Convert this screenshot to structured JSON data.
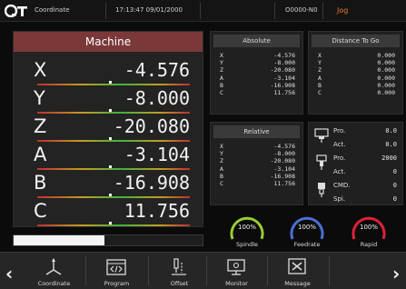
{
  "header": {
    "title": "Coordinate",
    "datetime": "17:13:47 09/01/2000",
    "program": "O0000-N0",
    "mode": "Jog",
    "logo_text": "QT"
  },
  "machine": {
    "title": "Machine",
    "axes": [
      {
        "label": "X",
        "value": "-4.576"
      },
      {
        "label": "Y",
        "value": "-8.000"
      },
      {
        "label": "Z",
        "value": "-20.080"
      },
      {
        "label": "A",
        "value": "-3.104"
      },
      {
        "label": "B",
        "value": "-16.908"
      },
      {
        "label": "C",
        "value": "11.756"
      }
    ]
  },
  "absolute": {
    "title": "Absolute",
    "rows": [
      {
        "label": "X",
        "value": "-4.576"
      },
      {
        "label": "Y",
        "value": "-8.000"
      },
      {
        "label": "Z",
        "value": "-20.080"
      },
      {
        "label": "A",
        "value": "-3.104"
      },
      {
        "label": "B",
        "value": "-16.908"
      },
      {
        "label": "C",
        "value": "11.756"
      }
    ]
  },
  "distance": {
    "title": "Distance To Go",
    "rows": [
      {
        "label": "X",
        "value": "0.000"
      },
      {
        "label": "Y",
        "value": "0.000"
      },
      {
        "label": "Z",
        "value": "0.000"
      },
      {
        "label": "A",
        "value": "0.000"
      },
      {
        "label": "B",
        "value": "0.000"
      },
      {
        "label": "C",
        "value": "0.000"
      }
    ]
  },
  "relative": {
    "title": "Relative",
    "rows": [
      {
        "label": "X",
        "value": "-4.576"
      },
      {
        "label": "Y",
        "value": "-8.000"
      },
      {
        "label": "Z",
        "value": "-20.080"
      },
      {
        "label": "A",
        "value": "-3.104"
      },
      {
        "label": "B",
        "value": "-16.908"
      },
      {
        "label": "C",
        "value": "11.756"
      }
    ]
  },
  "status": {
    "rows": [
      {
        "label": "Pro.",
        "value": "0.0",
        "icon": "feed-icon"
      },
      {
        "label": "Act.",
        "value": "0.0",
        "icon": ""
      },
      {
        "label": "Pro.",
        "value": "2000",
        "icon": "spindle-icon"
      },
      {
        "label": "Act.",
        "value": "0",
        "icon": ""
      },
      {
        "label": "CMD.",
        "value": "0",
        "icon": "tool-icon"
      },
      {
        "label": "Spi.",
        "value": "0",
        "icon": ""
      }
    ]
  },
  "gauges": [
    {
      "label": "Spindle",
      "value": "100%",
      "percent": 100,
      "color": "#9acd32"
    },
    {
      "label": "Feedrate",
      "value": "100%",
      "percent": 100,
      "color": "#4a6fd6"
    },
    {
      "label": "Rapid",
      "value": "100%",
      "percent": 100,
      "color": "#e0203a"
    }
  ],
  "progress": {
    "fraction": 0.48
  },
  "nav": {
    "left_arrow": "‹",
    "right_arrow": "›",
    "buttons": [
      {
        "label": "Coordinate",
        "icon": "axes-icon"
      },
      {
        "label": "Program",
        "icon": "code-icon"
      },
      {
        "label": "Offset",
        "icon": "offset-icon"
      },
      {
        "label": "Monitor",
        "icon": "monitor-icon"
      },
      {
        "label": "Message",
        "icon": "message-icon"
      }
    ]
  },
  "colors": {
    "mode_accent": "#f07a2a",
    "machine_header": "#7a3838"
  }
}
